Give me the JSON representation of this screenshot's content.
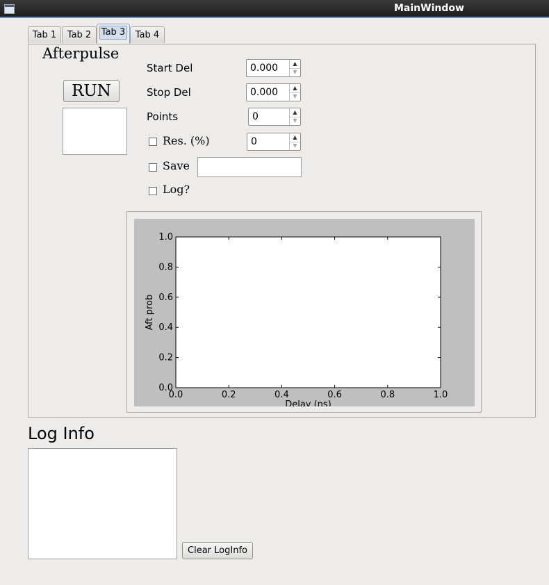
{
  "window": {
    "title": "MainWindow"
  },
  "tabs": [
    {
      "label": "Tab 1"
    },
    {
      "label": "Tab 2"
    },
    {
      "label": "Tab 3"
    },
    {
      "label": "Tab 4"
    }
  ],
  "active_tab": "Tab 3",
  "afterpulse": {
    "heading": "Afterpulse",
    "run_label": "RUN",
    "fields": {
      "start_del": {
        "label": "Start Del",
        "value": "0.000"
      },
      "stop_del": {
        "label": "Stop Del",
        "value": "0.000"
      },
      "points": {
        "label": "Points",
        "value": "0"
      },
      "res": {
        "label": "Res. (%)",
        "value": "0",
        "checked": false
      }
    },
    "save": {
      "label": "Save",
      "checked": false,
      "value": ""
    },
    "log": {
      "label": "Log?",
      "checked": false
    }
  },
  "log_info": {
    "title": "Log Info",
    "clear_label": "Clear LogInfo",
    "text": ""
  },
  "chart_data": {
    "type": "line",
    "series": [],
    "xlabel": "Delay (ns)",
    "ylabel": "Aft prob",
    "xlim": [
      0.0,
      1.0
    ],
    "ylim": [
      0.0,
      1.0
    ],
    "x_ticks": [
      "0.0",
      "0.2",
      "0.4",
      "0.6",
      "0.8",
      "1.0"
    ],
    "y_ticks": [
      "0.0",
      "0.2",
      "0.4",
      "0.6",
      "0.8",
      "1.0"
    ],
    "grid": false
  }
}
